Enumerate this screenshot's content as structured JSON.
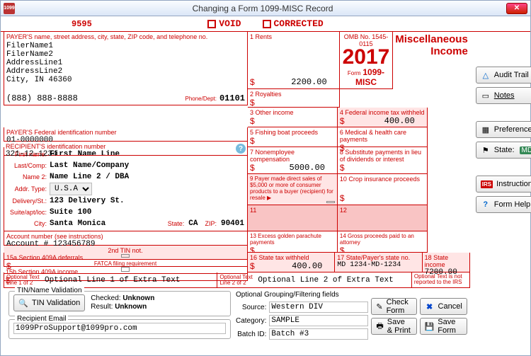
{
  "window": {
    "title": "Changing a Form 1099-MISC Record",
    "icon_text": "1099"
  },
  "top": {
    "number": "9595",
    "void": "VOID",
    "corrected": "CORRECTED"
  },
  "header_block": {
    "omb": "OMB No. 1545-0115",
    "year": "2017",
    "form_label": "Form",
    "form_name": "1099-MISC",
    "misc": "Miscellaneous Income"
  },
  "payer": {
    "header": "PAYER'S name, street address, city, state, ZIP code, and telephone no.",
    "name1": "FilerName1",
    "name2": "FilerName2",
    "addr1": "AddressLine1",
    "addr2": "AddressLine2",
    "citystate": "City, IN 46360",
    "phone": "(888) 888-8888",
    "phonedept_label": "Phone/Dept:",
    "phonedept": "01101",
    "fedid_label": "PAYER'S Federal identification number",
    "fedid": "01-0000000"
  },
  "recipient": {
    "idnum_label": "RECIPIENT'S identification number",
    "idnum": "321-12-1234",
    "firstname_label": "First name:",
    "firstname": "First Name Line",
    "lastcomp_label": "Last/Comp:",
    "lastcomp": "Last Name/Company",
    "name2_label": "Name 2:",
    "name2": "Name Line 2 / DBA",
    "addrtype_label": "Addr. Type:",
    "addrtype": "U.S.A.",
    "delivery_label": "Delivery/St.:",
    "delivery": "123 Delivery St.",
    "suite_label": "Suite/apt/loc:",
    "suite": "Suite 100",
    "city_label": "City:",
    "city": "Santa Monica",
    "state_label": "State:",
    "state": "CA",
    "zip_label": "ZIP:",
    "zip": "90401",
    "acct_label": "Account number (see instructions)",
    "acct": "Account # 123456789",
    "tin2_label": "2nd TIN not.",
    "fatca_label": "FATCA filing requirement"
  },
  "boxes": {
    "b1_label": "1  Rents",
    "b1": "2200.00",
    "b2_label": "2 Royalties",
    "b2": "",
    "b3_label": "3 Other income",
    "b3": "",
    "b4_label": "4 Federal income tax withheld",
    "b4": "400.00",
    "b5_label": "5 Fishing boat proceeds",
    "b5": "",
    "b6_label": "6 Medical & health care payments",
    "b6": "",
    "b7_label": "7 Nonemployee compensation",
    "b7": "5000.00",
    "b8_label": "8 Substitute payments in lieu of dividends or interest",
    "b8": "",
    "b9_label": "9 Payer made direct sales of $5,000 or more of consumer products to a buyer (recipient) for resale  ▶",
    "b10_label": "10 Crop insurance proceeds",
    "b10": "",
    "b11_label": "11",
    "b12_label": "12",
    "b13_label": "13 Excess golden parachute payments",
    "b13": "",
    "b14_label": "14 Gross proceeds paid to an attorney",
    "b14": "",
    "b15a_label": "15a Section 409A deferrals",
    "b15a": "",
    "b15b_label": "15b Section 409A income",
    "b15b": "",
    "b16_label": "16 State tax withheld",
    "b16": "400.00",
    "b17_label": "17 State/Payer's state no.",
    "b17": "MD 1234-MD-1234",
    "b18_label": "18   State income",
    "b18": "7200.00"
  },
  "optional": {
    "l1_label": "Optional Text Line 1 of 2",
    "l1": "Optional Line 1 of Extra Text",
    "l2_label": "Optional Text Line 2 of 2",
    "l2": "Optional Line 2 of Extra Text",
    "note": "Optional Text is not reported to the IRS"
  },
  "tin": {
    "group": "TIN/Name Validation",
    "btn": "TIN Validation",
    "checked_label": "Checked:",
    "checked": "Unknown",
    "result_label": "Result:",
    "result": "Unknown"
  },
  "recip_email": {
    "group": "Recipient Email",
    "value": "1099ProSupport@1099pro.com"
  },
  "grouping": {
    "header": "Optional Grouping/Filtering fields",
    "source_label": "Source:",
    "source": "Western DIV",
    "category_label": "Category:",
    "category": "SAMPLE",
    "batch_label": "Batch ID:",
    "batch": "Batch #3"
  },
  "sidebar": {
    "audit": "Audit Trail",
    "notes": "Notes",
    "prefs": "Preferences",
    "state_prefix": "State:",
    "state_val": "MD",
    "instructions": "Instructions",
    "formhelp": "Form Help"
  },
  "buttons": {
    "check": "Check Form",
    "cancel": "Cancel",
    "saveprint": "Save & Print",
    "save": "Save Form"
  }
}
